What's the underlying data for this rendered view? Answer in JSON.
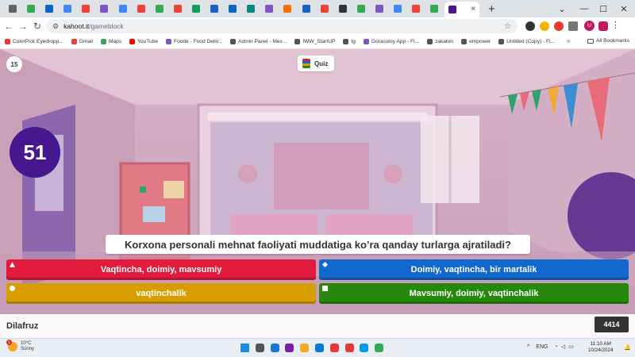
{
  "browser": {
    "tab_favicon_colors": [
      "#5f6368",
      "#34a853",
      "#0a66c2",
      "#4285f4",
      "#ea4335",
      "#7e57c2",
      "#4285f4",
      "#ea4335",
      "#34a853",
      "#ea4335",
      "#0f9d58",
      "#1565c0",
      "#0a66c2",
      "#00897b",
      "#7e57c2",
      "#ff6d00",
      "#1565c0",
      "#ea4335",
      "#333333",
      "#34a853",
      "#7e57c2",
      "#4285f4",
      "#ea4335",
      "#34a853"
    ],
    "active_tab_close": "×",
    "new_tab": "+",
    "window_controls": [
      "⌄",
      "—",
      "☐",
      "✕"
    ],
    "address_host": "kahoot.it",
    "address_path": "/gameblock",
    "profile_initial": "U",
    "bookmarks": [
      {
        "label": "ColorPick Eyedropp...",
        "color": "#e53935"
      },
      {
        "label": "Gmail",
        "color": "#ea4335"
      },
      {
        "label": "Maps",
        "color": "#34a853"
      },
      {
        "label": "YouTube",
        "color": "#ff0000"
      },
      {
        "label": "Foode - Food Deliv...",
        "color": "#7e57c2"
      },
      {
        "label": "Admin Panel - Mex...",
        "color": "#555555"
      },
      {
        "label": "IWW_StartUP",
        "color": "#555555"
      },
      {
        "label": "tg",
        "color": "#555555"
      },
      {
        "label": "Gorasstoy App - Fi...",
        "color": "#7e57c2"
      },
      {
        "label": "zakaton",
        "color": "#555555"
      },
      {
        "label": "empower",
        "color": "#555555"
      },
      {
        "label": "Untitled (Copy) - Fi...",
        "color": "#555555"
      }
    ],
    "bookmarks_more": "»",
    "all_bookmarks": "All Bookmarks"
  },
  "game": {
    "question_counter": "15",
    "mode_label": "Quiz",
    "timer": "51",
    "question": "Korxona personali mehnat faoliyati muddatiga ko’ra qanday turlarga ajratiladi?",
    "answers": [
      {
        "text": "Vaqtincha, doimiy, mavsumiy",
        "color": "#e21b3c",
        "shape": "triangle"
      },
      {
        "text": "Doimiy, vaqtincha, bir martalik",
        "color": "#1368ce",
        "shape": "diamond"
      },
      {
        "text": "vaqtinchalik",
        "color": "#d89e00",
        "shape": "circle"
      },
      {
        "text": "Mavsumiy, doimiy, vaqtinchalik",
        "color": "#26890c",
        "shape": "square"
      }
    ],
    "player_name": "Dilafruz",
    "score": "4414"
  },
  "taskbar": {
    "weather_temp": "10°C",
    "weather_desc": "Sunny",
    "weather_badge": "1",
    "app_colors": [
      "#1e88e5",
      "#555555",
      "#1976d2",
      "#7b1fa2",
      "#f9a825",
      "#0078d4",
      "#e53935",
      "#e53935",
      "#039be5",
      "#34a853"
    ],
    "language": "ENG",
    "time": "11:10 AM",
    "date": "10/24/2024"
  }
}
